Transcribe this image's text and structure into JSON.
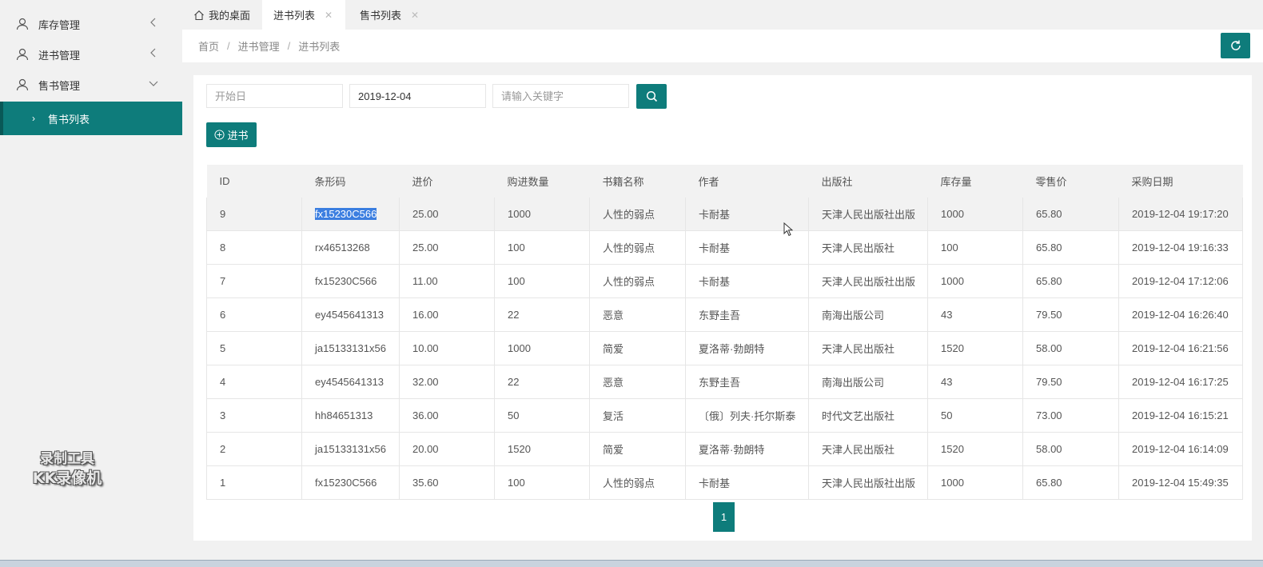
{
  "sidebar": {
    "items": [
      {
        "label": "库存管理",
        "expanded": false
      },
      {
        "label": "进书管理",
        "expanded": false
      },
      {
        "label": "售书管理",
        "expanded": true
      }
    ],
    "sub_item": "售书列表"
  },
  "watermark": {
    "line1": "录制工具",
    "line2": "KK录像机"
  },
  "tabs": [
    {
      "label": "我的桌面",
      "icon": "home-icon"
    },
    {
      "label": "进书列表",
      "active": true
    },
    {
      "label": "售书列表"
    }
  ],
  "breadcrumb": [
    "首页",
    "进书管理",
    "进书列表"
  ],
  "filters": {
    "start_placeholder": "开始日",
    "end_value": "2019-12-04",
    "keyword_placeholder": "请输入关键字"
  },
  "add_button": "进书",
  "table": {
    "headers": [
      "ID",
      "条形码",
      "进价",
      "购进数量",
      "书籍名称",
      "作者",
      "出版社",
      "库存量",
      "零售价",
      "采购日期"
    ],
    "rows": [
      [
        "9",
        "fx15230C566",
        "25.00",
        "1000",
        "人性的弱点",
        "卡耐基",
        "天津人民出版社出版",
        "1000",
        "65.80",
        "2019-12-04 19:17:20"
      ],
      [
        "8",
        "rx46513268",
        "25.00",
        "100",
        "人性的弱点",
        "卡耐基",
        "天津人民出版社",
        "100",
        "65.80",
        "2019-12-04 19:16:33"
      ],
      [
        "7",
        "fx15230C566",
        "11.00",
        "100",
        "人性的弱点",
        "卡耐基",
        "天津人民出版社出版",
        "1000",
        "65.80",
        "2019-12-04 17:12:06"
      ],
      [
        "6",
        "ey4545641313",
        "16.00",
        "22",
        "恶意",
        "东野圭吾",
        "南海出版公司",
        "43",
        "79.50",
        "2019-12-04 16:26:40"
      ],
      [
        "5",
        "ja15133131x56",
        "10.00",
        "1000",
        "简爱",
        "夏洛蒂·勃朗特",
        "天津人民出版社",
        "1520",
        "58.00",
        "2019-12-04 16:21:56"
      ],
      [
        "4",
        "ey4545641313",
        "32.00",
        "22",
        "恶意",
        "东野圭吾",
        "南海出版公司",
        "43",
        "79.50",
        "2019-12-04 16:17:25"
      ],
      [
        "3",
        "hh84651313",
        "36.00",
        "50",
        "复活",
        "〔俄〕列夫·托尔斯泰",
        "时代文艺出版社",
        "50",
        "73.00",
        "2019-12-04 16:15:21"
      ],
      [
        "2",
        "ja15133131x56",
        "20.00",
        "1520",
        "简爱",
        "夏洛蒂·勃朗特",
        "天津人民出版社",
        "1520",
        "58.00",
        "2019-12-04 16:14:09"
      ],
      [
        "1",
        "fx15230C566",
        "35.60",
        "100",
        "人性的弱点",
        "卡耐基",
        "天津人民出版社出版",
        "1000",
        "65.80",
        "2019-12-04 15:49:35"
      ]
    ]
  },
  "pagination": {
    "current": "1"
  },
  "colors": {
    "accent": "#0e7c7b",
    "selection": "#3b7ee0"
  }
}
